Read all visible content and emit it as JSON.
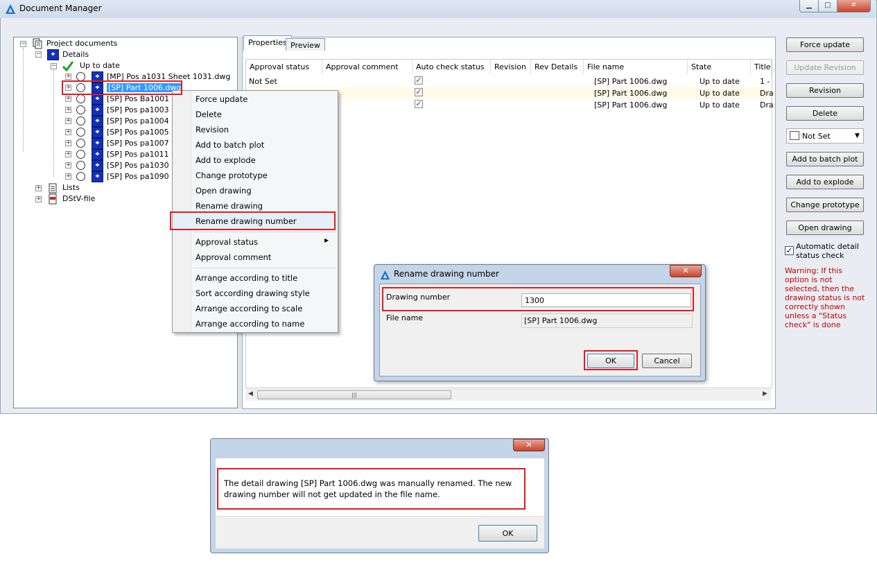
{
  "window": {
    "title": "Document Manager"
  },
  "tree": {
    "root": "Project documents",
    "details": "Details",
    "up_to_date": "Up to date",
    "items": [
      "[MP] Pos a1031 Sheet 1031.dwg",
      "[SP] Part 1006.dwg",
      "[SP] Pos Ba1001 Sh",
      "[SP] Pos pa1003 Sh",
      "[SP] Pos pa1004 Sh",
      "[SP] Pos pa1005 Sh",
      "[SP] Pos pa1007 Sh",
      "[SP] Pos pa1011 Sh",
      "[SP] Pos pa1030 Sh",
      "[SP] Pos pa1090 Sh"
    ],
    "lists": "Lists",
    "dstv": "DStV-file"
  },
  "tabs": [
    "Properties",
    "Preview"
  ],
  "grid": {
    "columns": [
      "Approval status",
      "Approval comment",
      "Auto check status",
      "Revision",
      "Rev Details",
      "File name",
      "State",
      "Title"
    ],
    "rows": [
      {
        "approval_status": "Not Set",
        "file_name": "[SP] Part 1006.dwg",
        "state": "Up to date",
        "title": "1 -",
        "auto_check": true
      },
      {
        "approval_status": "",
        "file_name": "[SP] Part 1006.dwg",
        "state": "Up to date",
        "title": "Dra",
        "auto_check": true
      },
      {
        "approval_status": "",
        "file_name": "[SP] Part 1006.dwg",
        "state": "Up to date",
        "title": "Dra",
        "auto_check": true
      }
    ]
  },
  "side_buttons": {
    "force_update": "Force update",
    "update_revision": "Update Revision",
    "revision": "Revision",
    "delete": "Delete",
    "status_select": "Not Set",
    "add_batch": "Add to batch plot",
    "add_explode": "Add to explode",
    "change_proto": "Change prototype",
    "open_drawing": "Open drawing",
    "auto_check_label": "Automatic detail status check",
    "auto_check_checked": true,
    "warning": "Warning: If this option is not selected, then the drawing status is not correctly shown unless a \"Status check\" is done"
  },
  "context_menu": {
    "items": [
      "Force update",
      "Delete",
      "Revision",
      "Add to batch plot",
      "Add to explode",
      "Change prototype",
      "Open drawing",
      "Rename drawing",
      "Rename drawing number",
      "Approval status",
      "Approval comment",
      "Arrange according to title",
      "Sort according drawing style",
      "Arrange according to scale",
      "Arrange according to name"
    ]
  },
  "rename_dialog": {
    "title": "Rename drawing number",
    "drawing_number_label": "Drawing number",
    "drawing_number_value": "1300",
    "file_name_label": "File name",
    "file_name_value": "[SP] Part 1006.dwg",
    "ok": "OK",
    "cancel": "Cancel"
  },
  "message_dialog": {
    "text": "The detail drawing [SP] Part 1006.dwg was manually renamed. The new drawing number will not get updated in the file name.",
    "ok": "OK"
  },
  "colors": {
    "highlight": "#e01b24",
    "selection": "#3399ff",
    "warning": "#c00000",
    "dwg_icon": "#1530b8"
  }
}
